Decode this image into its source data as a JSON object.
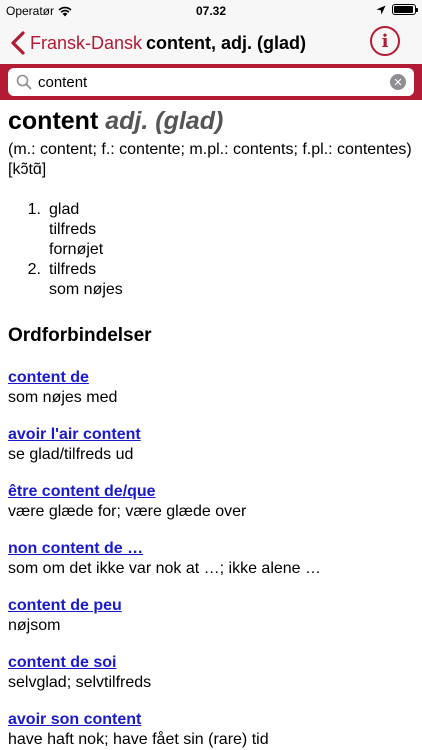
{
  "status_bar": {
    "carrier": "Operatør",
    "time": "07.32",
    "wifi_icon": "wifi-icon",
    "location_icon": "location-arrow-icon",
    "battery_level": 0.95
  },
  "nav": {
    "back_label": "Fransk-Dansk",
    "title": "content, adj. (glad)",
    "info_label": "i"
  },
  "search": {
    "value": "content"
  },
  "entry": {
    "headword": "content",
    "pos": "adj. (glad)",
    "forms": "(m.: content; f.: contente; m.pl.: contents; f.pl.: contentes)",
    "pronunciation": "[kɔ̃tɑ̃]",
    "senses": [
      {
        "num": "1.",
        "lines": [
          "glad",
          "tilfreds",
          "fornøjet"
        ]
      },
      {
        "num": "2.",
        "lines": [
          "tilfreds",
          "som nøjes"
        ]
      }
    ]
  },
  "phrases_heading": "Ordforbindelser",
  "phrases": [
    {
      "phrase": "content de",
      "translation": "som nøjes med"
    },
    {
      "phrase": "avoir l'air content",
      "translation": "se glad/tilfreds ud"
    },
    {
      "phrase": "être content de/que",
      "translation": "være glæde for; være glæde over"
    },
    {
      "phrase": "non content de …",
      "translation": "som om det ikke var nok at …; ikke alene …"
    },
    {
      "phrase": "content de peu",
      "translation": "nøjsom"
    },
    {
      "phrase": "content de soi",
      "translation": "selvglad; selvtilfreds"
    },
    {
      "phrase": "avoir son content",
      "translation": "have haft nok; have fået sin (rare) tid"
    }
  ]
}
